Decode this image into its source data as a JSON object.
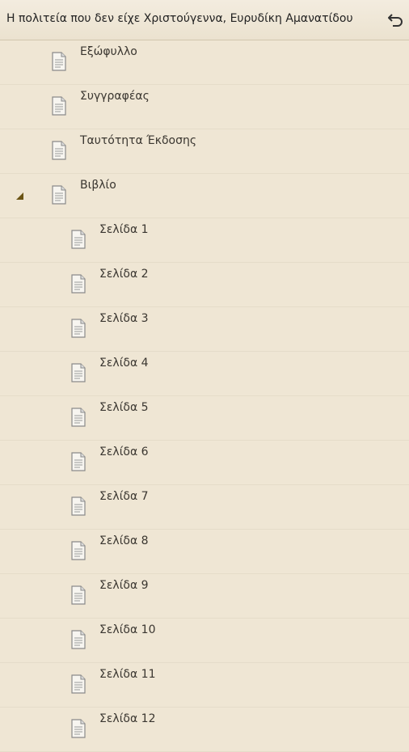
{
  "header": {
    "title": "Η πολιτεία που δεν είχε Χριστούγεννα, Ευρυδίκη Αμανατίδου",
    "back_icon": "back-arrow-icon"
  },
  "toc": {
    "items": [
      {
        "label": "Εξώφυλλο",
        "level": 0
      },
      {
        "label": "Συγγραφέας",
        "level": 0
      },
      {
        "label": "Ταυτότητα Έκδοσης",
        "level": 0
      },
      {
        "label": "Βιβλίο",
        "level": 0,
        "expanded": true
      },
      {
        "label": "Σελίδα 1",
        "level": 1
      },
      {
        "label": "Σελίδα 2",
        "level": 1
      },
      {
        "label": "Σελίδα 3",
        "level": 1
      },
      {
        "label": "Σελίδα 4",
        "level": 1
      },
      {
        "label": "Σελίδα 5",
        "level": 1
      },
      {
        "label": "Σελίδα 6",
        "level": 1
      },
      {
        "label": "Σελίδα 7",
        "level": 1
      },
      {
        "label": "Σελίδα 8",
        "level": 1
      },
      {
        "label": "Σελίδα 9",
        "level": 1
      },
      {
        "label": "Σελίδα 10",
        "level": 1
      },
      {
        "label": "Σελίδα 11",
        "level": 1
      },
      {
        "label": "Σελίδα 12",
        "level": 1
      }
    ]
  },
  "colors": {
    "background": "#efe6d4",
    "expander": "#6b5414",
    "text": "#3a3630"
  }
}
